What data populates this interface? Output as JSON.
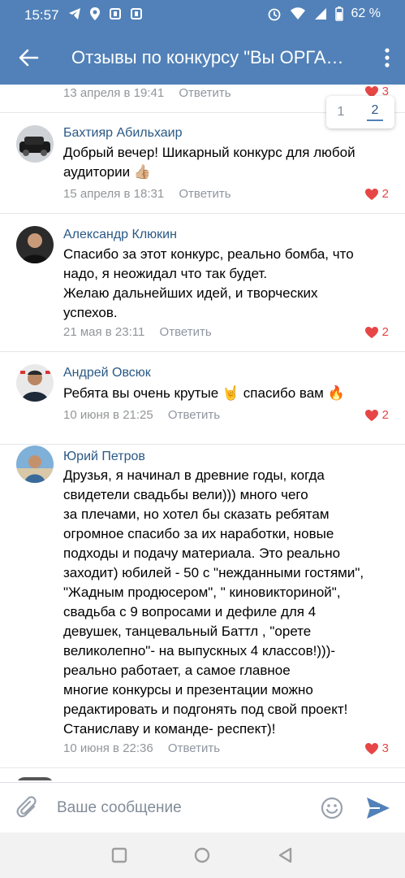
{
  "status_bar": {
    "time": "15:57",
    "battery": "62 %"
  },
  "header": {
    "title": "Отзывы по конкурсу \"Вы ОРГАНИЗАТОР\""
  },
  "pagination": {
    "page1": "1",
    "page2": "2"
  },
  "comments": [
    {
      "name": "",
      "lines": [],
      "date": "13 апреля в 19:41",
      "reply": "Ответить",
      "likes": "3"
    },
    {
      "name": "Бахтияр Абильхаир",
      "lines": [
        "Добрый вечер! Шикарный конкурс для любой",
        "аудитории 👍🏼"
      ],
      "date": "15 апреля в 18:31",
      "reply": "Ответить",
      "likes": "2"
    },
    {
      "name": "Александр Клюкин",
      "lines": [
        "Спасибо за этот конкурс, реально бомба, что",
        "надо, я неожидал что так будет.",
        "Желаю дальнейших идей, и творческих",
        "успехов."
      ],
      "date": "21 мая в 23:11",
      "reply": "Ответить",
      "likes": "2"
    },
    {
      "name": "Андрей Овсюк",
      "lines": [
        "Ребята вы очень крутые 🤘 спасибо вам 🔥"
      ],
      "date": "10 июня в 21:25",
      "reply": "Ответить",
      "likes": "2"
    },
    {
      "name": "Юрий Петров",
      "lines": [
        "Друзья, я начинал в древние годы, когда",
        "свидетели свадьбы вели))) много чего",
        "за плечами, но хотел бы сказать ребятам",
        "огромное спасибо за их наработки, новые",
        "подходы и подачу материала. Это реально",
        "заходит) юбилей - 50 с \"нежданными гостями\",",
        "\"Жадным продюсером\", \" киновикториной\",",
        "свадьба с 9 вопросами и дефиле для 4",
        "девушек, танцевальный Баттл , \"орете",
        "великолепно\"- на выпускных 4 классов!)))-",
        "реально работает, а самое главное",
        "многие конкурсы и презентации можно",
        "редактировать и подгонять под свой проект!",
        "Станиславу и команде- респект)!"
      ],
      "date": "10 июня в 22:36",
      "reply": "Ответить",
      "likes": "3"
    }
  ],
  "composer": {
    "placeholder": "Ваше сообщение"
  },
  "colors": {
    "brand": "#5181b8",
    "name": "#2a5885",
    "like": "#e64646"
  }
}
